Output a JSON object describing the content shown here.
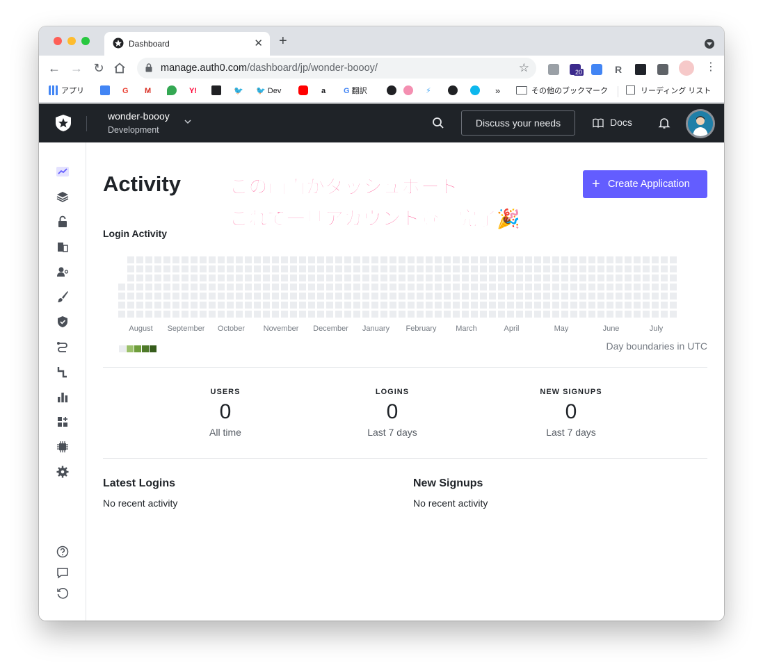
{
  "browser": {
    "tab_title": "Dashboard",
    "url_host": "manage.auth0.com",
    "url_path": "/dashboard/jp/wonder-boooy/",
    "extension_badge": "20",
    "bookmarks": [
      {
        "label": "アプリ",
        "icon": "apps-grid-icon",
        "color": "#4285f4"
      },
      {
        "label": "",
        "icon": "calendar-icon",
        "color": "#4285f4"
      },
      {
        "label": "",
        "icon": "google-icon",
        "color": "#ea4335"
      },
      {
        "label": "",
        "icon": "gmail-icon",
        "color": "#d93025"
      },
      {
        "label": "",
        "icon": "maps-icon",
        "color": "#34a853"
      },
      {
        "label": "",
        "icon": "yahoo-icon",
        "color": "#ff0033"
      },
      {
        "label": "",
        "icon": "bookmark-icon",
        "color": "#202124"
      },
      {
        "label": "",
        "icon": "twitter-icon",
        "color": "#1da1f2"
      },
      {
        "label": "Dev",
        "icon": "twitter-icon",
        "color": "#1da1f2"
      },
      {
        "label": "",
        "icon": "youtube-icon",
        "color": "#ff0000"
      },
      {
        "label": "",
        "icon": "amazon-icon",
        "color": "#202124"
      },
      {
        "label": "翻訳",
        "icon": "google-icon",
        "color": "#4285f4"
      },
      {
        "label": "",
        "icon": "globe-icon",
        "color": "#202124"
      },
      {
        "label": "",
        "icon": "flower-icon",
        "color": "#f48fb1"
      },
      {
        "label": "",
        "icon": "flutter-icon",
        "color": "#42a5f5"
      },
      {
        "label": "",
        "icon": "github-icon",
        "color": "#202124"
      },
      {
        "label": "",
        "icon": "docker-icon",
        "color": "#0db7ed"
      }
    ],
    "bookmarks_more": "»",
    "other_bookmarks": "その他のブックマーク",
    "reading_list": "リーディング リスト"
  },
  "header": {
    "tenant_name": "wonder-boooy",
    "tenant_env": "Development",
    "discuss_label": "Discuss your needs",
    "docs_label": "Docs"
  },
  "sidebar": {
    "items": [
      {
        "icon": "activity-chart-icon",
        "active": true
      },
      {
        "icon": "applications-layers-icon",
        "active": false
      },
      {
        "icon": "authentication-lock-icon",
        "active": false
      },
      {
        "icon": "organizations-building-icon",
        "active": false
      },
      {
        "icon": "user-management-icon",
        "active": false
      },
      {
        "icon": "branding-brush-icon",
        "active": false
      },
      {
        "icon": "security-shield-icon",
        "active": false
      },
      {
        "icon": "actions-flow-icon",
        "active": false
      },
      {
        "icon": "auth-pipeline-icon",
        "active": false
      },
      {
        "icon": "monitoring-bars-icon",
        "active": false
      },
      {
        "icon": "marketplace-icon",
        "active": false
      },
      {
        "icon": "extensions-chip-icon",
        "active": false
      },
      {
        "icon": "settings-gear-icon",
        "active": false
      }
    ],
    "bottom_items": [
      {
        "icon": "help-icon"
      },
      {
        "icon": "feedback-chat-icon"
      },
      {
        "icon": "history-icon"
      }
    ]
  },
  "main": {
    "title": "Activity",
    "create_button": "Create Application",
    "annotation_line1": "この画面がダッシュボード。",
    "annotation_line2": "これで一旦アカウント登録完了🎉",
    "login_activity_title": "Login Activity",
    "months": [
      "August",
      "September",
      "October",
      "November",
      "December",
      "January",
      "February",
      "March",
      "April",
      "May",
      "June",
      "July"
    ],
    "legend_colors": [
      "#ebedf0",
      "#9bc06b",
      "#6f9e3c",
      "#4f7a2a",
      "#365c1c"
    ],
    "day_boundaries_note": "Day boundaries in UTC",
    "stats": [
      {
        "label": "USERS",
        "value": "0",
        "sub": "All time"
      },
      {
        "label": "LOGINS",
        "value": "0",
        "sub": "Last 7 days"
      },
      {
        "label": "NEW SIGNUPS",
        "value": "0",
        "sub": "Last 7 days"
      }
    ],
    "latest_logins_title": "Latest Logins",
    "latest_logins_empty": "No recent activity",
    "new_signups_title": "New Signups",
    "new_signups_empty": "No recent activity"
  },
  "colors": {
    "accent": "#635dff",
    "header_bg": "#1f2328",
    "annotation": "#ff2d78",
    "heat_empty": "#ebedf0"
  }
}
